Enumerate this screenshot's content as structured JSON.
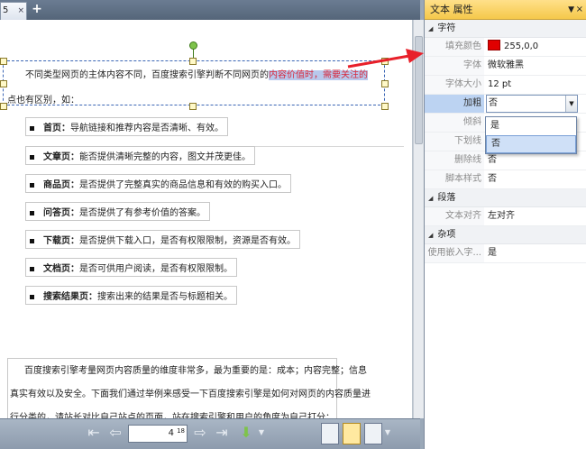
{
  "tab": {
    "title": "5",
    "close": "×",
    "add": "+"
  },
  "doc": {
    "para1_line1_a": "不同类型网页的主体内容不同，百度搜索引擎判断不同网页的",
    "para1_line1_hl": "内容价值时，需要关注的",
    "para1_line2": "点也有区别，如：",
    "bullets": [
      {
        "term": "首页：",
        "desc": "导航链接和推荐内容是否清晰、有效。"
      },
      {
        "term": "文章页：",
        "desc": "能否提供清晰完整的内容，图文并茂更佳。"
      },
      {
        "term": "商品页：",
        "desc": "是否提供了完整真实的商品信息和有效的购买入口。"
      },
      {
        "term": "问答页：",
        "desc": "是否提供了有参考价值的答案。"
      },
      {
        "term": "下载页：",
        "desc": "是否提供下载入口，是否有权限限制，资源是否有效。"
      },
      {
        "term": "文档页：",
        "desc": "是否可供用户阅读，是否有权限限制。"
      },
      {
        "term": "搜索结果页：",
        "desc": "搜索出来的结果是否与标题相关。"
      }
    ],
    "para2": [
      "百度搜索引擎考量网页内容质量的维度非常多，最为重要的是：成本；内容完整；信息",
      "真实有效以及安全。下面我们通过举例来感受一下百度搜索引擎是如何对网页的内容质量进",
      "行分类的，请站长对比自己站点的页面，站在搜索引擎和用户的角度为自己打分："
    ]
  },
  "nav": {
    "page": "4",
    "total": "18"
  },
  "panel": {
    "title": "文本 属性",
    "pin": "▼",
    "close": "×",
    "sections": {
      "char": "字符",
      "para": "段落",
      "misc": "杂项"
    },
    "props": {
      "fill_color_k": "填充颜色",
      "fill_color_v": "255,0,0",
      "font_k": "字体",
      "font_v": "微软雅黑",
      "size_k": "字体大小",
      "size_v": "12 pt",
      "bold_k": "加粗",
      "bold_v": "否",
      "italic_k": "倾斜",
      "underline_k": "下划线",
      "strike_k": "删除线",
      "strike_v": "否",
      "script_k": "脚本样式",
      "script_v": "否",
      "align_k": "文本对齐",
      "align_v": "左对齐",
      "embed_k": "使用嵌入字...",
      "embed_v": "是"
    },
    "dropdown_options": [
      "是",
      "否"
    ]
  },
  "colors": {
    "fill_swatch": "#e00000",
    "header": "#f5c84a"
  }
}
